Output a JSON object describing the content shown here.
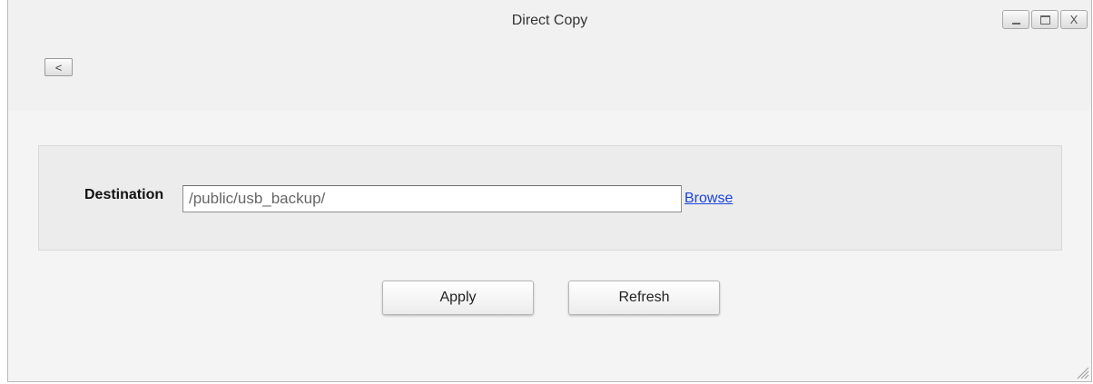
{
  "window": {
    "title": "Direct Copy",
    "controls": [
      {
        "name": "minimize",
        "icon": "minimize-icon"
      },
      {
        "name": "maximize",
        "icon": "maximize-icon"
      },
      {
        "name": "close",
        "icon": "close-icon",
        "glyph": "X"
      }
    ]
  },
  "toolbar": {
    "back_label": "<"
  },
  "form": {
    "destination_label": "Destination",
    "destination_value": "/public/usb_backup/",
    "browse_label": "Browse"
  },
  "actions": {
    "apply_label": "Apply",
    "refresh_label": "Refresh"
  },
  "colors": {
    "link": "#1a44d8",
    "window_bg": "#f1f1f1",
    "panel_bg": "#ececec"
  }
}
